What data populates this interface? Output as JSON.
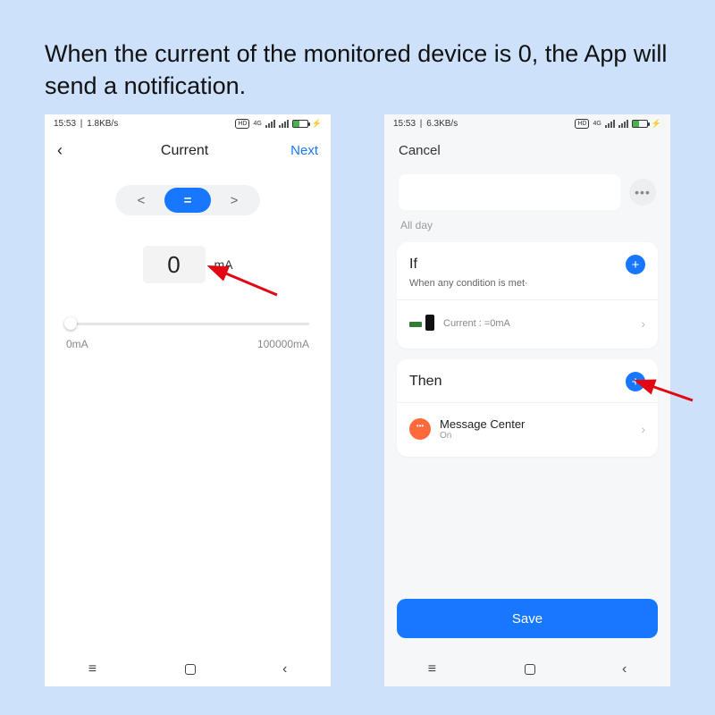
{
  "caption": "When the current of the monitored device is 0, the App will send a notification.",
  "status": {
    "time": "15:53",
    "rate1": "1.8KB/s",
    "rate2": "6.3KB/s",
    "hd": "HD",
    "net": "4G"
  },
  "screen1": {
    "title": "Current",
    "next": "Next",
    "ops": {
      "lt": "<",
      "eq": "=",
      "gt": ">"
    },
    "value": "0",
    "unit": "mA",
    "min": "0mA",
    "max": "100000mA"
  },
  "screen2": {
    "cancel": "Cancel",
    "all_day": "All day",
    "if": {
      "title": "If",
      "subtitle": "When any condition is met·",
      "item": "Current : =0mA"
    },
    "then": {
      "title": "Then",
      "msg_title": "Message Center",
      "msg_sub": "On"
    },
    "save": "Save"
  },
  "nav": {
    "menu": "≡",
    "back": "‹"
  },
  "colors": {
    "accent": "#1877ff",
    "arrow": "#e30613"
  }
}
